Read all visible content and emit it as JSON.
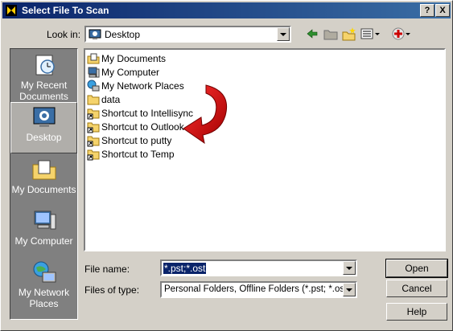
{
  "window": {
    "title": "Select File To Scan"
  },
  "titlebar": {
    "help_label": "?",
    "close_label": "X"
  },
  "lookin": {
    "label": "Look in:",
    "value": "Desktop"
  },
  "places": [
    {
      "label": "My Recent Documents",
      "icon": "recent-documents-icon"
    },
    {
      "label": "Desktop",
      "icon": "desktop-icon"
    },
    {
      "label": "My Documents",
      "icon": "my-documents-icon"
    },
    {
      "label": "My Computer",
      "icon": "my-computer-icon"
    },
    {
      "label": "My Network Places",
      "icon": "network-places-icon"
    }
  ],
  "files": [
    {
      "name": "My Documents",
      "icon": "folder-docs"
    },
    {
      "name": "My Computer",
      "icon": "computer"
    },
    {
      "name": "My Network Places",
      "icon": "network"
    },
    {
      "name": "data",
      "icon": "folder"
    },
    {
      "name": "Shortcut to Intellisync",
      "icon": "folder-shortcut"
    },
    {
      "name": "Shortcut to Outlook",
      "icon": "folder-shortcut"
    },
    {
      "name": "Shortcut to putty",
      "icon": "folder-shortcut"
    },
    {
      "name": "Shortcut to Temp",
      "icon": "folder-shortcut"
    }
  ],
  "filename": {
    "label": "File name:",
    "value": "*.pst;*.ost"
  },
  "filetype": {
    "label": "Files of type:",
    "value": "Personal Folders, Offline Folders (*.pst; *.ost)"
  },
  "buttons": {
    "open": "Open",
    "cancel": "Cancel",
    "help": "Help"
  },
  "colors": {
    "titlebar": "#0a246a",
    "face": "#d4d0c8",
    "places_bg": "#808080",
    "arrow": "#cc0000"
  }
}
